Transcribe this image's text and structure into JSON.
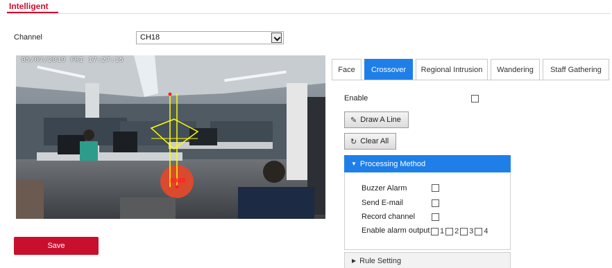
{
  "header": {
    "title": "Intelligent"
  },
  "channel": {
    "label": "Channel",
    "value": "CH18"
  },
  "video": {
    "osd_time": "05/07/2019 FRI 17:27:15",
    "overlay_text": "8048"
  },
  "tabs": [
    {
      "label": "Face",
      "active": false
    },
    {
      "label": "Crossover",
      "active": true
    },
    {
      "label": "Regional Intrusion",
      "active": false
    },
    {
      "label": "Wandering",
      "active": false
    },
    {
      "label": "Staff Gathering",
      "active": false
    }
  ],
  "crossover": {
    "enable_label": "Enable",
    "enable_checked": false,
    "draw_line_label": "Draw A Line",
    "clear_all_label": "Clear All"
  },
  "processing": {
    "title": "Processing Method",
    "buzzer_label": "Buzzer Alarm",
    "email_label": "Send E-mail",
    "record_label": "Record channel",
    "alarm_output_label": "Enable alarm output",
    "outputs": [
      "1",
      "2",
      "3",
      "4"
    ]
  },
  "rule": {
    "title": "Rule Setting"
  },
  "save_label": "Save",
  "colors": {
    "accent_red": "#c8102e",
    "accent_blue": "#1e7fe8"
  },
  "icons": {
    "draw": "pencil-icon",
    "clear": "refresh-icon"
  }
}
